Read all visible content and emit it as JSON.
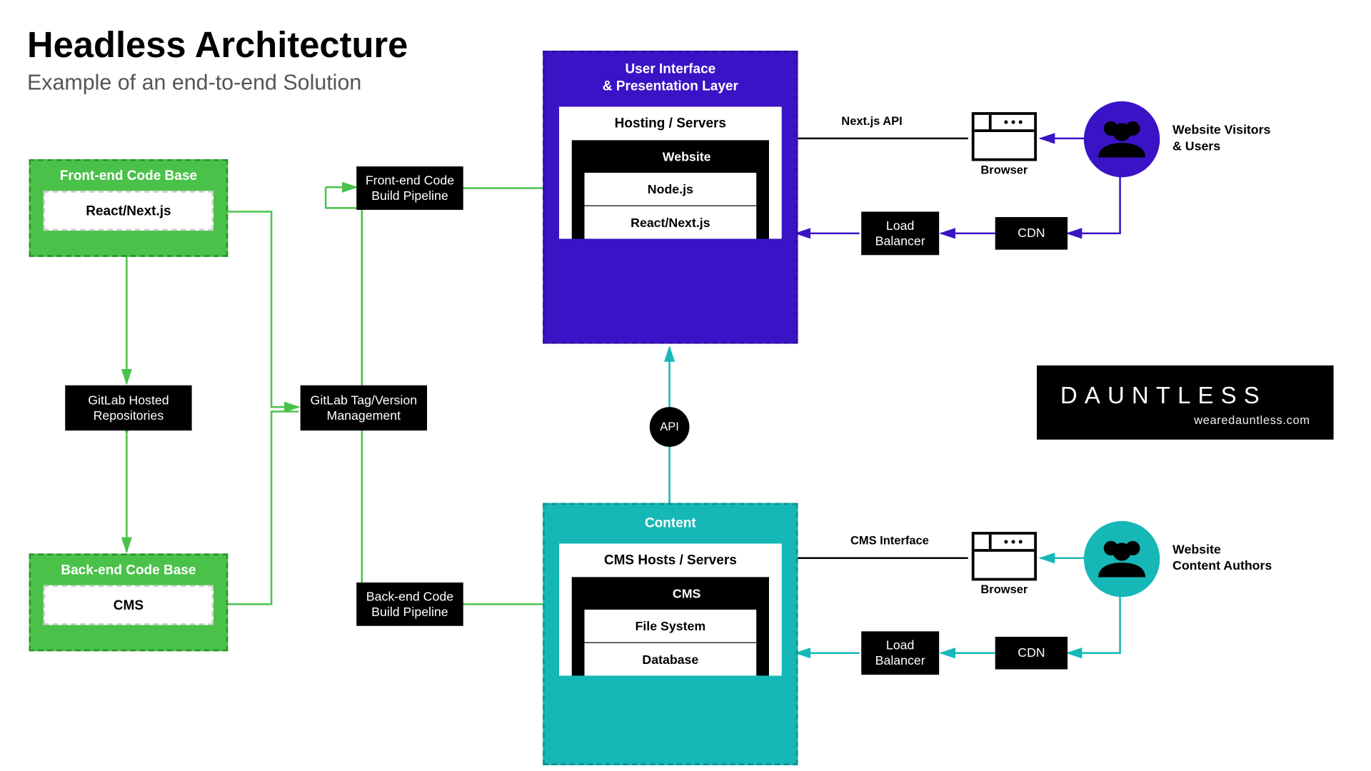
{
  "title": "Headless Architecture",
  "subtitle": "Example of an end-to-end Solution",
  "codebases": {
    "front": {
      "header": "Front-end Code Base",
      "item": "React/Next.js"
    },
    "back": {
      "header": "Back-end Code Base",
      "item": "CMS"
    }
  },
  "pipeline": {
    "repo": "GitLab Hosted\nRepositories",
    "version": "GitLab Tag/Version\nManagement",
    "fe_build": "Front-end Code\nBuild Pipeline",
    "be_build": "Back-end Code\nBuild Pipeline"
  },
  "ui_layer": {
    "title": "User Interface\n& Presentation Layer",
    "hosting": "Hosting / Servers",
    "app": "Website",
    "stack": [
      "Node.js",
      "React/Next.js"
    ]
  },
  "content_layer": {
    "title": "Content",
    "hosting": "CMS Hosts / Servers",
    "app": "CMS",
    "stack": [
      "File System",
      "Database"
    ]
  },
  "api_label": "API",
  "delivery": {
    "top": {
      "lb": "Load\nBalancer",
      "cdn": "CDN",
      "api_name": "Next.js API",
      "browser": "Browser"
    },
    "bottom": {
      "lb": "Load\nBalancer",
      "cdn": "CDN",
      "api_name": "CMS Interface",
      "browser": "Browser"
    }
  },
  "audiences": {
    "visitors": "Website Visitors\n& Users",
    "authors": "Website\nContent Authors"
  },
  "brand": {
    "name": "DAUNTLESS",
    "url": "wearedauntless.com"
  },
  "colors": {
    "green": "#4ac24a",
    "purple": "#3b13c6",
    "teal": "#16b7b7",
    "black": "#000000"
  }
}
